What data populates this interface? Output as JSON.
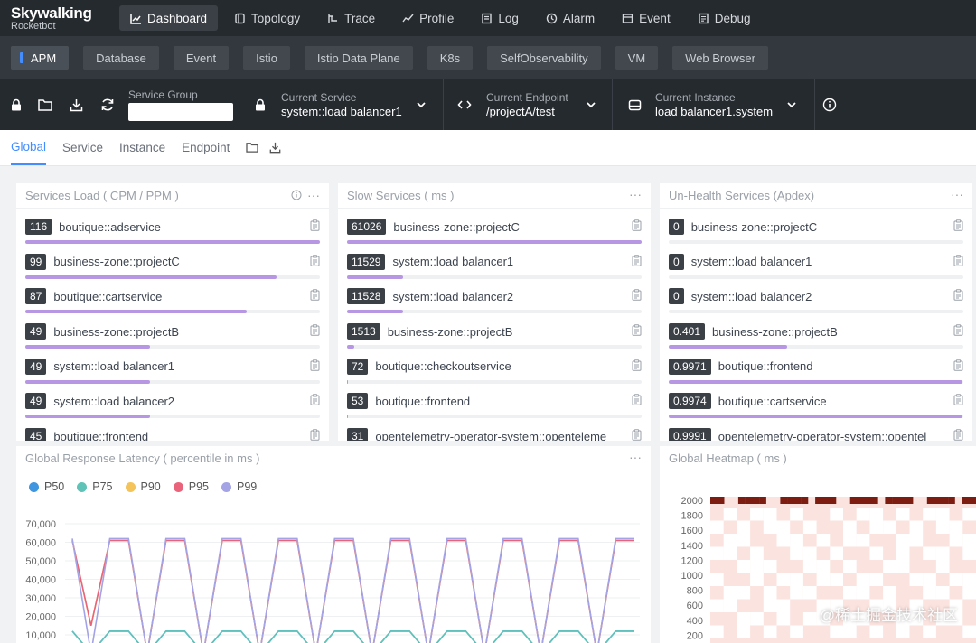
{
  "brand": {
    "line1": "Skywalking",
    "line2": "Rocketbot"
  },
  "nav": [
    {
      "label": "Dashboard",
      "icon": "dashboard-icon",
      "active": true
    },
    {
      "label": "Topology",
      "icon": "topology-icon"
    },
    {
      "label": "Trace",
      "icon": "trace-icon"
    },
    {
      "label": "Profile",
      "icon": "profile-icon"
    },
    {
      "label": "Log",
      "icon": "log-icon"
    },
    {
      "label": "Alarm",
      "icon": "alarm-icon"
    },
    {
      "label": "Event",
      "icon": "event-icon"
    },
    {
      "label": "Debug",
      "icon": "debug-icon"
    }
  ],
  "layers": [
    "APM",
    "Database",
    "Event",
    "Istio",
    "Istio Data Plane",
    "K8s",
    "SelfObservability",
    "VM",
    "Web Browser"
  ],
  "selectors": {
    "group_label": "Service Group",
    "group_value": "",
    "service": {
      "label": "Current Service",
      "value": "system::load balancer1"
    },
    "endpoint": {
      "label": "Current Endpoint",
      "value": "/projectA/test"
    },
    "instance": {
      "label": "Current Instance",
      "value": "load balancer1.system"
    }
  },
  "tabs": [
    "Global",
    "Service",
    "Instance",
    "Endpoint"
  ],
  "services_load": {
    "title": "Services Load ( CPM / PPM )",
    "max": 116,
    "items": [
      {
        "value": "116",
        "name": "boutique::adservice"
      },
      {
        "value": "99",
        "name": "business-zone::projectC"
      },
      {
        "value": "87",
        "name": "boutique::cartservice"
      },
      {
        "value": "49",
        "name": "business-zone::projectB"
      },
      {
        "value": "49",
        "name": "system::load balancer1"
      },
      {
        "value": "49",
        "name": "system::load balancer2"
      },
      {
        "value": "45",
        "name": "boutique::frontend"
      }
    ]
  },
  "slow_services": {
    "title": "Slow Services ( ms )",
    "max": 61026,
    "items": [
      {
        "value": "61026",
        "name": "business-zone::projectC"
      },
      {
        "value": "11529",
        "name": "system::load balancer1"
      },
      {
        "value": "11528",
        "name": "system::load balancer2"
      },
      {
        "value": "1513",
        "name": "business-zone::projectB"
      },
      {
        "value": "72",
        "name": "boutique::checkoutservice"
      },
      {
        "value": "53",
        "name": "boutique::frontend"
      },
      {
        "value": "31",
        "name": "opentelemetry-operator-system::openteleme"
      }
    ]
  },
  "unhealth_services": {
    "title": "Un-Health Services (Apdex)",
    "max": 1,
    "items": [
      {
        "value": "0",
        "name": "business-zone::projectC"
      },
      {
        "value": "0",
        "name": "system::load balancer1"
      },
      {
        "value": "0",
        "name": "system::load balancer2"
      },
      {
        "value": "0.401",
        "name": "business-zone::projectB"
      },
      {
        "value": "0.9971",
        "name": "boutique::frontend"
      },
      {
        "value": "0.9974",
        "name": "boutique::cartservice"
      },
      {
        "value": "0.9991",
        "name": "opentelemetry-operator-system::opentel"
      }
    ]
  },
  "latency": {
    "title": "Global Response Latency ( percentile in ms )"
  },
  "heatmap": {
    "title": "Global Heatmap ( ms )"
  },
  "watermark": "@稀土掘金技术社区",
  "chart_data": [
    {
      "type": "line",
      "title": "Global Response Latency ( percentile in ms )",
      "yticks": [
        "70,000",
        "60,000",
        "50,000",
        "40,000",
        "30,000",
        "20,000",
        "10,000"
      ],
      "ylim": [
        0,
        75000
      ],
      "legend": "top-left",
      "colors": [
        "#3f96e0",
        "#5fc3b8",
        "#f4c35a",
        "#e9647a",
        "#a3a3e6"
      ],
      "series": [
        {
          "name": "P50",
          "values": [
            12000,
            0,
            12000,
            12000,
            0,
            12000,
            12000,
            0,
            12000,
            12000,
            0,
            12000,
            12000,
            0,
            12000,
            12000,
            0,
            12000,
            12000,
            0,
            12000,
            12000,
            0,
            12000,
            12000,
            0,
            12000,
            12000,
            0,
            12000,
            12000
          ]
        },
        {
          "name": "P75",
          "values": [
            12000,
            0,
            12000,
            12000,
            0,
            12000,
            12000,
            0,
            12000,
            12000,
            0,
            12000,
            12000,
            0,
            12000,
            12000,
            0,
            12000,
            12000,
            0,
            12000,
            12000,
            0,
            12000,
            12000,
            0,
            12000,
            12000,
            0,
            12000,
            12000
          ]
        },
        {
          "name": "P90",
          "values": [
            61000,
            15000,
            61000,
            61000,
            0,
            61000,
            61000,
            0,
            61000,
            61000,
            0,
            61000,
            61000,
            0,
            61000,
            61000,
            0,
            61000,
            61000,
            0,
            61000,
            61000,
            0,
            61000,
            61000,
            0,
            61000,
            61000,
            0,
            61000,
            61000
          ]
        },
        {
          "name": "P95",
          "values": [
            61000,
            15000,
            61000,
            61000,
            0,
            61000,
            61000,
            0,
            61000,
            61000,
            0,
            61000,
            61000,
            0,
            61000,
            61000,
            0,
            61000,
            61000,
            0,
            61000,
            61000,
            0,
            61000,
            61000,
            0,
            61000,
            61000,
            0,
            61000,
            61000
          ]
        },
        {
          "name": "P99",
          "values": [
            62000,
            0,
            62000,
            62000,
            0,
            62000,
            62000,
            0,
            62000,
            62000,
            0,
            62000,
            62000,
            0,
            62000,
            62000,
            0,
            62000,
            62000,
            0,
            62000,
            62000,
            0,
            62000,
            62000,
            0,
            62000,
            62000,
            0,
            62000,
            62000
          ]
        }
      ]
    },
    {
      "type": "heatmap",
      "title": "Global Heatmap ( ms )",
      "yticks": [
        "2000",
        "1800",
        "1600",
        "1400",
        "1200",
        "1000",
        "800",
        "600",
        "400",
        "200"
      ],
      "colors": {
        "high": "#7d1d12",
        "low": "#fbe3df",
        "empty": "#ffffff"
      },
      "top_row": [
        1,
        1,
        0,
        0,
        1,
        1,
        1,
        1,
        0,
        0,
        1,
        1,
        1,
        1,
        0,
        1,
        1,
        1,
        0,
        0,
        1,
        1,
        1,
        1,
        0,
        1,
        1,
        1,
        1,
        0,
        0,
        1,
        1,
        1,
        1,
        0,
        1,
        1
      ],
      "cells": [
        [
          0,
          1,
          0,
          1,
          1,
          0,
          1,
          0,
          0,
          1,
          0,
          1,
          1,
          0,
          1,
          0,
          1,
          1,
          0,
          1
        ],
        [
          1,
          0,
          1,
          0,
          1,
          1,
          0,
          1,
          0,
          0,
          1,
          0,
          1,
          1,
          0,
          1,
          0,
          1,
          1,
          0
        ],
        [
          0,
          1,
          1,
          0,
          0,
          1,
          1,
          0,
          1,
          0,
          1,
          1,
          0,
          0,
          1,
          1,
          0,
          0,
          1,
          1
        ],
        [
          1,
          1,
          0,
          1,
          0,
          0,
          1,
          1,
          0,
          1,
          0,
          0,
          1,
          0,
          1,
          0,
          1,
          1,
          0,
          1
        ],
        [
          0,
          0,
          1,
          1,
          1,
          0,
          0,
          1,
          1,
          0,
          1,
          0,
          0,
          1,
          1,
          0,
          0,
          1,
          0,
          0
        ],
        [
          1,
          0,
          0,
          1,
          0,
          1,
          1,
          0,
          1,
          1,
          0,
          1,
          1,
          0,
          0,
          1,
          1,
          0,
          1,
          1
        ],
        [
          0,
          1,
          1,
          0,
          1,
          0,
          1,
          1,
          0,
          0,
          1,
          1,
          0,
          1,
          0,
          0,
          1,
          1,
          0,
          1
        ],
        [
          1,
          1,
          0,
          0,
          1,
          1,
          0,
          0,
          1,
          1,
          0,
          0,
          1,
          1,
          0,
          1,
          0,
          0,
          1,
          0
        ],
        [
          0,
          0,
          1,
          1,
          0,
          1,
          0,
          1,
          1,
          0,
          1,
          1,
          0,
          0,
          1,
          1,
          0,
          1,
          1,
          0
        ],
        [
          1,
          0,
          1,
          0,
          1,
          0,
          1,
          0,
          0,
          1,
          1,
          0,
          1,
          0,
          1,
          0,
          1,
          0,
          0,
          1
        ]
      ]
    }
  ]
}
